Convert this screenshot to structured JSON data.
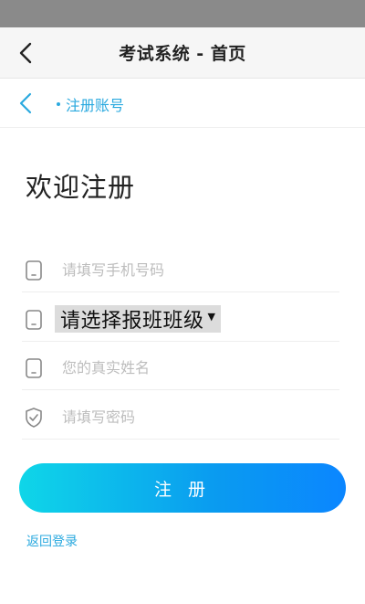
{
  "header": {
    "title": "考试系统 - 首页"
  },
  "subnav": {
    "breadcrumb": "注册账号"
  },
  "page": {
    "welcome": "欢迎注册"
  },
  "form": {
    "phone_placeholder": "请填写手机号码",
    "phone_value": "",
    "class_select_value": "请选择报班班级",
    "name_placeholder": "您的真实姓名",
    "name_value": "",
    "password_placeholder": "请填写密码",
    "password_value": ""
  },
  "actions": {
    "register_label": "注 册",
    "back_login_label": "返回登录"
  },
  "colors": {
    "accent": "#2aa9df",
    "button_gradient_start": "#0fd6e8",
    "button_gradient_end": "#0b86ff"
  },
  "icons": {
    "title_back": "chevron-left-icon",
    "subnav_back": "chevron-left-icon",
    "phone": "phone-icon",
    "class": "phone-icon",
    "name": "phone-icon",
    "password": "shield-check-icon"
  }
}
